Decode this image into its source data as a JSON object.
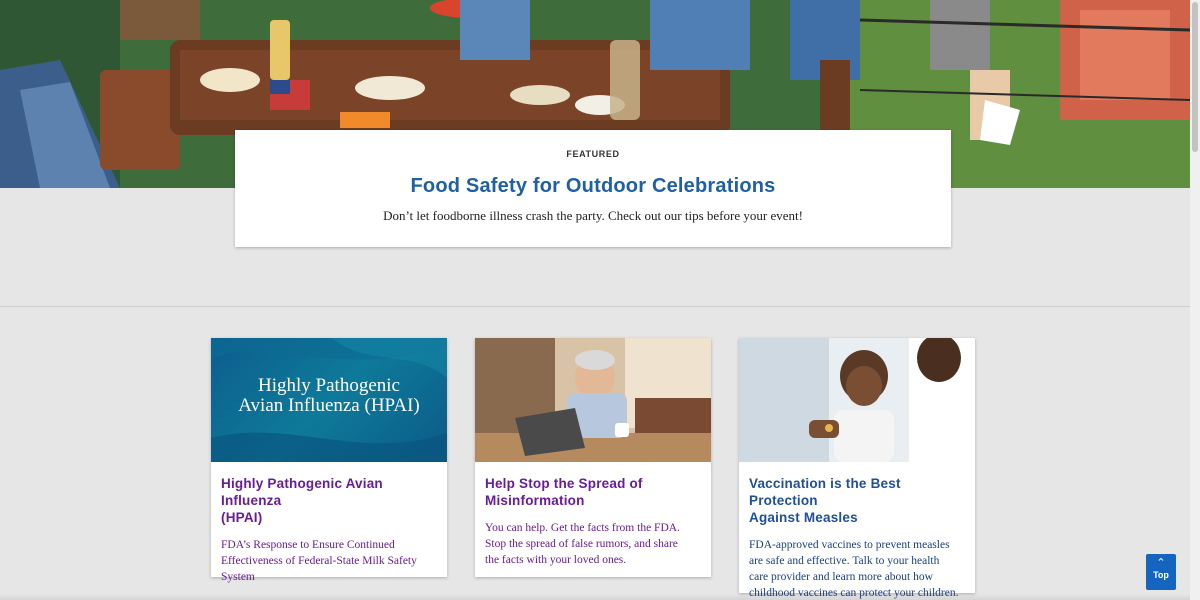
{
  "featured": {
    "eyebrow": "FEATURED",
    "title": "Food Safety for Outdoor Celebrations",
    "description": "Don’t let foodborne illness crash the party. Check out our tips before your event!"
  },
  "cards": [
    {
      "image_text": "Highly Pathogenic Avian Influenza (HPAI)",
      "image_line1": "Highly Pathogenic",
      "image_line2": "Avian Influenza (HPAI)",
      "title_line1": "Highly Pathogenic Avian Influenza",
      "title_line2": "(HPAI)",
      "desc_line1": "FDA’s Response to Ensure Continued",
      "desc_line2": "Effectiveness of Federal-State Milk Safety",
      "desc_line3": "System",
      "title_color": "#6a1b9a"
    },
    {
      "title_line1": "Help Stop the Spread of",
      "title_line2": "Misinformation",
      "desc_line1": "You can help. Get the facts from the FDA.",
      "desc_line2": "Stop the spread of false rumors, and share",
      "desc_line3": "the facts with your loved ones.",
      "title_color": "#6a1b9a"
    },
    {
      "title_line1": "Vaccination is the Best Protection",
      "title_line2": "Against Measles",
      "desc_line1": "FDA-approved vaccines to prevent measles",
      "desc_line2": "are safe and effective. Talk to your health",
      "desc_line3": "care provider and learn more about how",
      "desc_line4": "childhood vaccines can protect your children.",
      "title_color": "#1f4f9a"
    }
  ],
  "top_button": {
    "label": "Top",
    "icon": "chevron-up-icon"
  },
  "colors": {
    "link_blue": "#1f5fa6",
    "purple": "#6a1b9a",
    "top_button": "#1565c0"
  }
}
